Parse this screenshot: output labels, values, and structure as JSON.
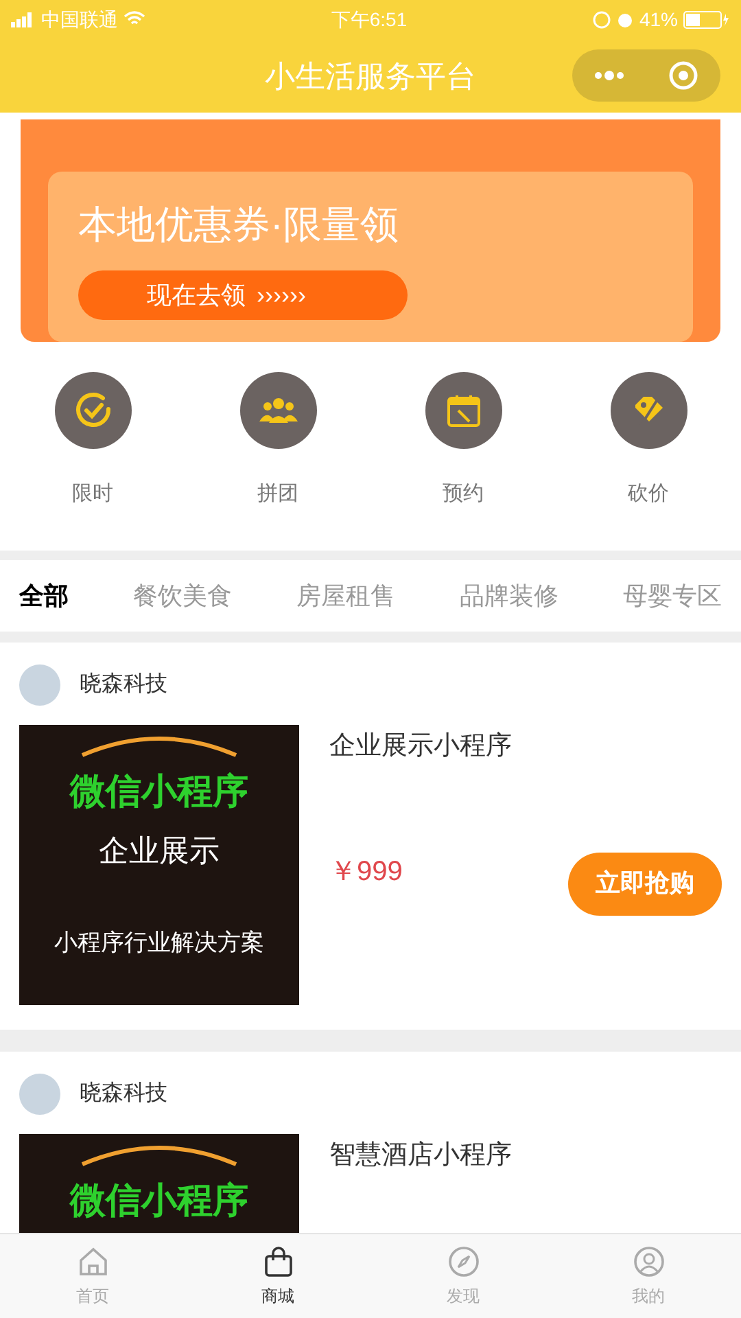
{
  "status_bar": {
    "carrier": "中国联通",
    "time": "下午6:51",
    "battery": "41%"
  },
  "nav": {
    "title": "小生活服务平台"
  },
  "banner": {
    "headline": "本地优惠券·限量领",
    "button": "现在去领",
    "arrows": "››››››"
  },
  "quick_entries": [
    {
      "kind": "clock",
      "label": "限时"
    },
    {
      "kind": "group",
      "label": "拼团"
    },
    {
      "kind": "calendar",
      "label": "预约"
    },
    {
      "kind": "tag",
      "label": "砍价"
    }
  ],
  "category_tabs": [
    {
      "label": "全部",
      "selected": true
    },
    {
      "label": "餐饮美食",
      "selected": false
    },
    {
      "label": "房屋租售",
      "selected": false
    },
    {
      "label": "品牌装修",
      "selected": false
    },
    {
      "label": "母婴专区",
      "selected": false
    }
  ],
  "products": [
    {
      "shop": "晓森科技",
      "title": "企业展示小程序",
      "image_texts": [
        "微信小程序",
        "企业展示",
        "小程序行业解决方案"
      ],
      "price": "￥999",
      "button": "立即抢购"
    },
    {
      "shop": "晓森科技",
      "title": "智慧酒店小程序",
      "image_texts": [
        "微信小程序"
      ]
    }
  ],
  "tab_bar": [
    {
      "kind": "home",
      "label": "首页",
      "selected": false
    },
    {
      "kind": "bag",
      "label": "商城",
      "selected": true
    },
    {
      "kind": "compass",
      "label": "发现",
      "selected": false
    },
    {
      "kind": "user",
      "label": "我的",
      "selected": false
    }
  ]
}
